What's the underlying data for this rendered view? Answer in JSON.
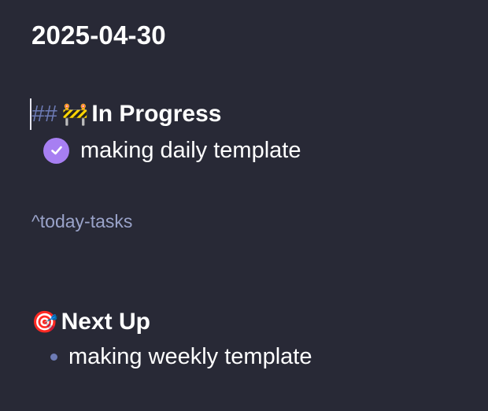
{
  "note": {
    "title": "2025-04-30"
  },
  "in_progress": {
    "markdown_prefix": "##",
    "emoji": "🚧",
    "emoji_icon": "construction-icon",
    "heading": "In Progress",
    "tasks": [
      {
        "text": "making daily template",
        "completed": true
      }
    ]
  },
  "block_reference": "^today-tasks",
  "next_up": {
    "emoji": "🎯",
    "emoji_icon": "target-icon",
    "heading": "Next Up",
    "items": [
      {
        "text": "making weekly template"
      }
    ]
  },
  "colors": {
    "background": "#282936",
    "text": "#ffffff",
    "markdown_syntax": "#6d7bb5",
    "checkbox_accent": "#a77ff2",
    "block_ref": "#9aa3c9"
  }
}
